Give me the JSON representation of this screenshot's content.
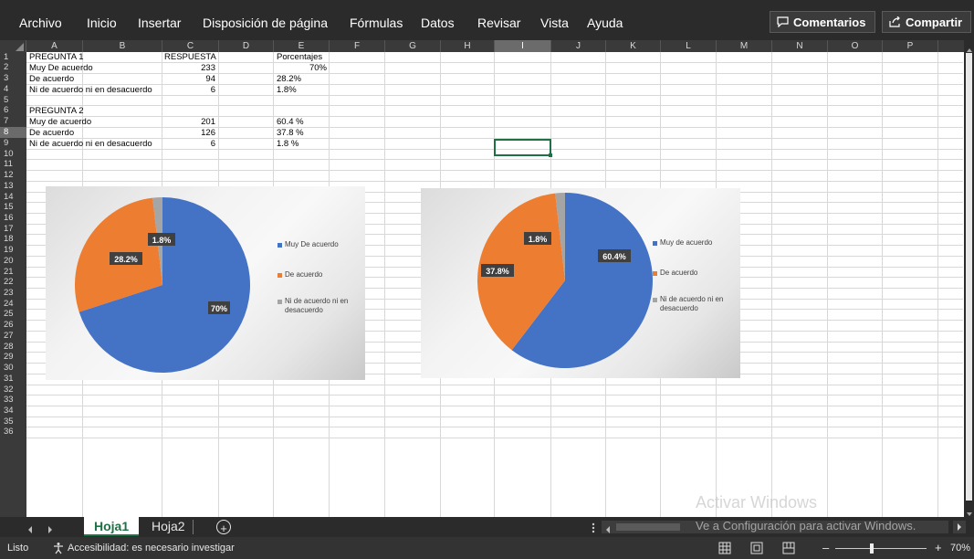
{
  "menu": {
    "items": [
      "Archivo",
      "Inicio",
      "Insertar",
      "Disposición de página",
      "Fórmulas",
      "Datos",
      "Revisar",
      "Vista",
      "Ayuda"
    ],
    "comments_label": "Comentarios",
    "share_label": "Compartir"
  },
  "columns": [
    "A",
    "B",
    "C",
    "D",
    "E",
    "F",
    "G",
    "H",
    "I",
    "J",
    "K",
    "L",
    "M",
    "N",
    "O",
    "P"
  ],
  "rows": [
    "1",
    "2",
    "3",
    "4",
    "5",
    "6",
    "7",
    "8",
    "9",
    "10",
    "11",
    "12",
    "13",
    "14",
    "15",
    "16",
    "17",
    "18",
    "19",
    "20",
    "21",
    "22",
    "23",
    "24",
    "25",
    "26",
    "27",
    "28",
    "29",
    "30",
    "31",
    "32",
    "33",
    "34",
    "35",
    "36"
  ],
  "sheet": {
    "r1": {
      "a": "PREGUNTA 1",
      "c": "RESPUESTA",
      "e": "Porcentajes"
    },
    "r2": {
      "a": "Muy De acuerdo",
      "c": "233",
      "e": "70%"
    },
    "r3": {
      "a": "De acuerdo",
      "c": "94",
      "e": "28.2%"
    },
    "r4": {
      "a": "Ni de acuerdo ni en desacuerdo",
      "c": "6",
      "e": "1.8%"
    },
    "r6": {
      "a": "PREGUNTA 2"
    },
    "r7": {
      "a": "Muy de acuerdo",
      "c": "201",
      "e": "60.4 %"
    },
    "r8": {
      "a": "De acuerdo",
      "c": "126",
      "e": "37.8 %"
    },
    "r9": {
      "a": "Ni de acuerdo ni en desacuerdo",
      "c": "6",
      "e": "1.8 %"
    }
  },
  "colors": {
    "blue": "#4472c4",
    "orange": "#ed7d31",
    "gray": "#a5a5a5",
    "excel_green": "#1e7145"
  },
  "chart_data": [
    {
      "type": "pie",
      "categories": [
        "Muy De acuerdo",
        "De acuerdo",
        "Ni de acuerdo ni en desacuerdo"
      ],
      "values": [
        70,
        28.2,
        1.8
      ],
      "data_labels": [
        "70%",
        "28.2%",
        "1.8%"
      ],
      "legend": [
        "Muy De acuerdo",
        "De acuerdo",
        "Ni de acuerdo ni en desacuerdo"
      ],
      "legend_position": "right"
    },
    {
      "type": "pie",
      "categories": [
        "Muy de acuerdo",
        "De acuerdo",
        "Ni de acuerdo ni en desacuerdo"
      ],
      "values": [
        60.4,
        37.8,
        1.8
      ],
      "data_labels": [
        "60.4%",
        "37.8%",
        "1.8%"
      ],
      "legend": [
        "Muy de acuerdo",
        "De acuerdo",
        "Ni de acuerdo ni en desacuerdo"
      ],
      "legend_position": "right"
    }
  ],
  "tabs": {
    "sheet1": "Hoja1",
    "sheet2": "Hoja2",
    "add": "+"
  },
  "status": {
    "ready": "Listo",
    "accessibility": "Accesibilidad: es necesario investigar",
    "zoom": "70%"
  },
  "watermark": {
    "title": "Activar Windows",
    "subtitle": "Ve a Configuración para activar Windows."
  }
}
